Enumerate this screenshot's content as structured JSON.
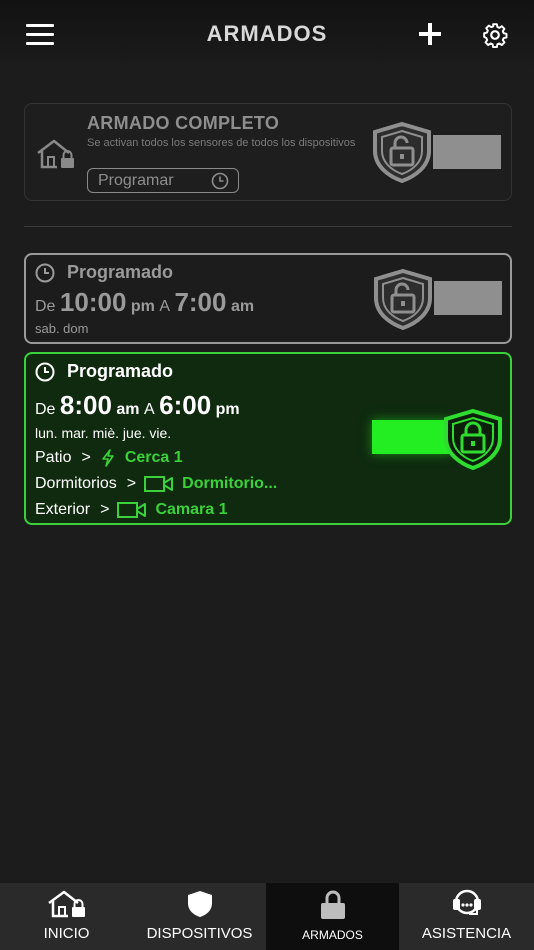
{
  "header": {
    "title": "ARMADOS",
    "menu_icon": "hamburger-icon",
    "add_icon": "plus-icon",
    "settings_icon": "gear-icon"
  },
  "full_arm": {
    "title": "ARMADO COMPLETO",
    "description": "Se activan todos los sensores de todos los dispositivos",
    "schedule_button": "Programar",
    "enabled": false
  },
  "schedules": [
    {
      "title": "Programado",
      "from_label": "De",
      "start_time": "10:00",
      "start_ampm": "pm",
      "to_label": "A",
      "end_time": "7:00",
      "end_ampm": "am",
      "days": "sab. dom",
      "enabled": false
    },
    {
      "title": "Programado",
      "from_label": "De",
      "start_time": "8:00",
      "start_ampm": "am",
      "to_label": "A",
      "end_time": "6:00",
      "end_ampm": "pm",
      "days": "lun. mar. miè. jue. vie.",
      "enabled": true,
      "rules": [
        {
          "zone": "Patio",
          "device": "Cerca 1",
          "device_icon": "fence-energy-icon"
        },
        {
          "zone": "Dormitorios",
          "device": "Dormitorio...",
          "device_icon": "camera-icon"
        },
        {
          "zone": "Exterior",
          "device": "Camara 1",
          "device_icon": "camera-icon"
        }
      ]
    }
  ],
  "nav": [
    {
      "label": "INICIO",
      "icon": "home-lock-icon"
    },
    {
      "label": "DISPOSITIVOS",
      "icon": "shield-icon"
    },
    {
      "label": "ARMADOS",
      "icon": "lock-icon",
      "active": true
    },
    {
      "label": "ASISTENCIA",
      "icon": "headset-icon"
    }
  ],
  "colors": {
    "accent_green": "#3ad13a",
    "inactive_gray": "#9a9a9a",
    "background": "#1c1c1c"
  }
}
